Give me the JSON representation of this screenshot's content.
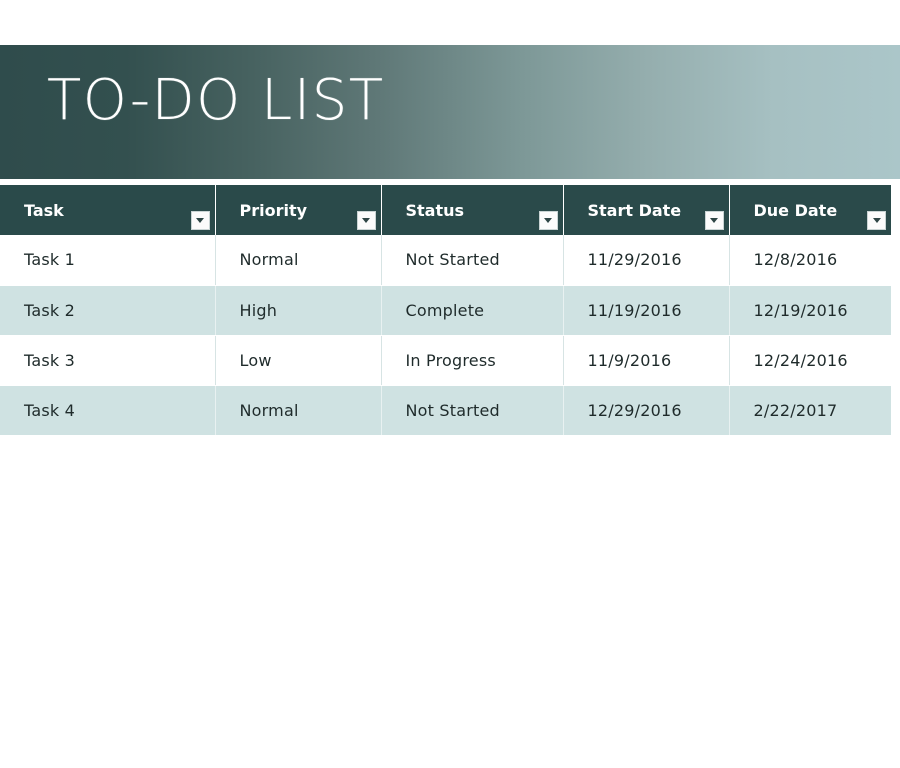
{
  "banner": {
    "title": "TO-DO LIST",
    "gradient_from": "#2f4c4c",
    "gradient_to": "#abc6c9"
  },
  "table": {
    "header_bg": "#2a4a4a",
    "header_text_color": "#ffffff",
    "row_alt_bg": "#cfe2e2",
    "row_bg": "#ffffff",
    "filter_icon": "chevron-down-icon",
    "columns": [
      {
        "key": "task",
        "label": "Task"
      },
      {
        "key": "priority",
        "label": "Priority"
      },
      {
        "key": "status",
        "label": "Status"
      },
      {
        "key": "start",
        "label": "Start Date"
      },
      {
        "key": "due",
        "label": "Due Date"
      }
    ],
    "rows": [
      {
        "task": "Task 1",
        "priority": "Normal",
        "status": "Not Started",
        "start": "11/29/2016",
        "due": "12/8/2016"
      },
      {
        "task": "Task 2",
        "priority": "High",
        "status": "Complete",
        "start": "11/19/2016",
        "due": "12/19/2016"
      },
      {
        "task": "Task 3",
        "priority": "Low",
        "status": "In Progress",
        "start": "11/9/2016",
        "due": "12/24/2016"
      },
      {
        "task": "Task 4",
        "priority": "Normal",
        "status": "Not Started",
        "start": "12/29/2016",
        "due": "2/22/2017"
      }
    ]
  }
}
